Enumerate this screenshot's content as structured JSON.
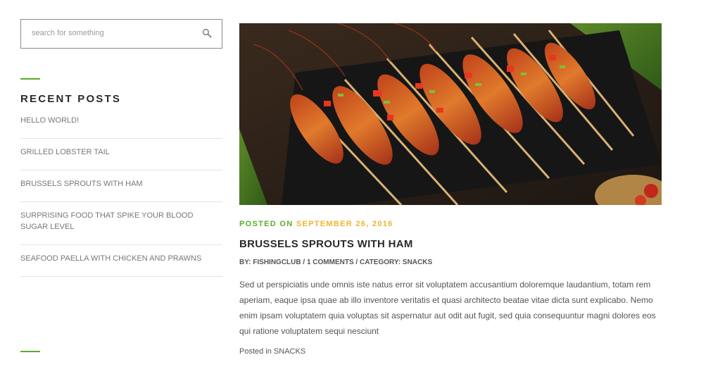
{
  "search": {
    "placeholder": "search for something",
    "icon": "search-icon"
  },
  "sidebar": {
    "recent_posts_title": "RECENT POSTS",
    "posts": [
      {
        "label": "HELLO WORLD!"
      },
      {
        "label": "GRILLED LOBSTER TAIL"
      },
      {
        "label": "BRUSSELS SPROUTS WITH HAM"
      },
      {
        "label": "SURPRISING FOOD THAT SPIKE YOUR BLOOD SUGAR LEVEL"
      },
      {
        "label": "SEAFOOD PAELLA WITH CHICKEN AND PRAWNS"
      }
    ]
  },
  "post": {
    "posted_on_label": "POSTED ON",
    "date": "SEPTEMBER 26, 2016",
    "title": "BRUSSELS SPROUTS WITH HAM",
    "byline_prefix": "BY:",
    "author": "FISHINGCLUB",
    "comments": "1 COMMENTS",
    "category_prefix": "CATEGORY:",
    "category": "SNACKS",
    "excerpt": "Sed ut perspiciatis unde omnis iste natus error sit voluptatem accusantium doloremque laudantium, totam rem aperiam, eaque ipsa quae ab illo inventore veritatis et quasi architecto beatae vitae dicta sunt explicabo. Nemo enim ipsam voluptatem quia voluptas sit aspernatur aut odit aut fugit, sed quia consequuntur magni dolores eos qui ratione voluptatem sequi nesciunt",
    "posted_in_label": "Posted in",
    "posted_in_category": "SNACKS"
  },
  "colors": {
    "accent_green": "#5aac2f",
    "date_yellow": "#f0b429",
    "title_dark": "#2a2a2a"
  }
}
